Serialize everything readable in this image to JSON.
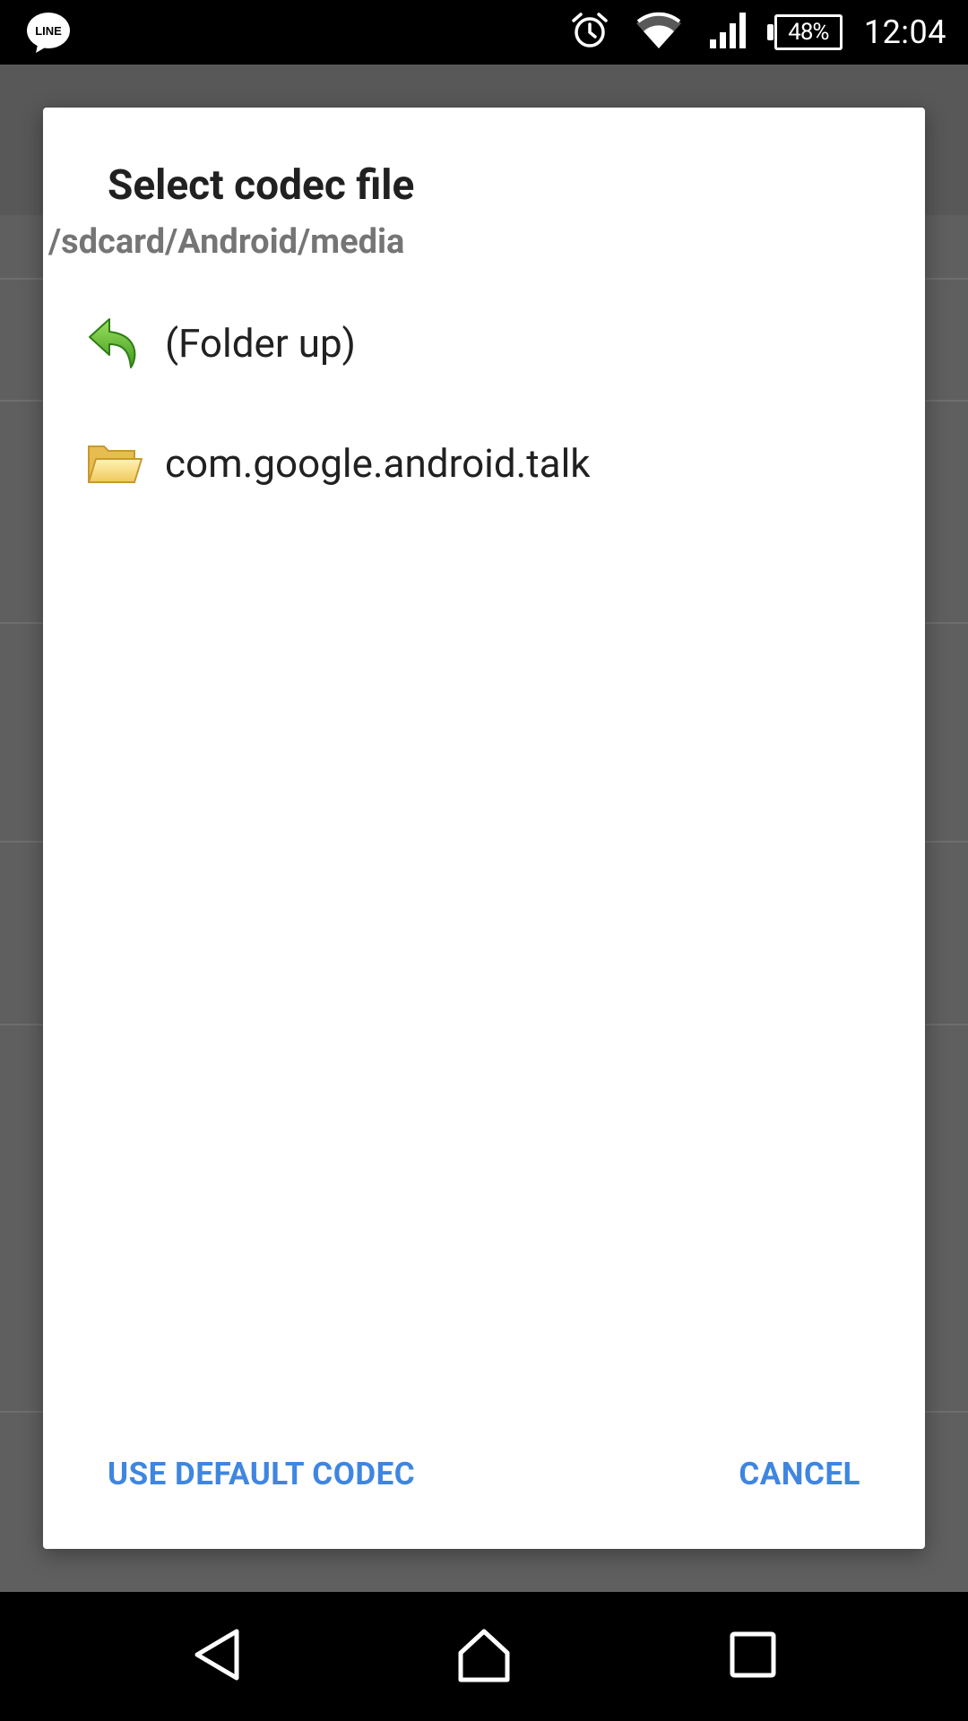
{
  "status_bar": {
    "left_icon": "line-app-icon",
    "left_icon_text": "LINE",
    "icons": [
      "alarm-icon",
      "wifi-icon",
      "signal-icon"
    ],
    "battery_percent": "48%",
    "time": "12:04"
  },
  "dialog": {
    "title": "Select codec file",
    "path": "/sdcard/Android/media",
    "items": [
      {
        "icon": "folder-up-icon",
        "label": "(Folder up)"
      },
      {
        "icon": "folder-icon",
        "label": "com.google.android.talk"
      }
    ],
    "actions": {
      "default_label": "USE DEFAULT CODEC",
      "cancel_label": "CANCEL"
    }
  },
  "colors": {
    "accent": "#3f86e0",
    "scrim": "#5f5f5f",
    "folder_up_green": "#5cb531",
    "folder_yellow": "#f3d36b"
  },
  "nav_bar": {
    "buttons": [
      "back-icon",
      "home-icon",
      "recents-icon"
    ]
  }
}
